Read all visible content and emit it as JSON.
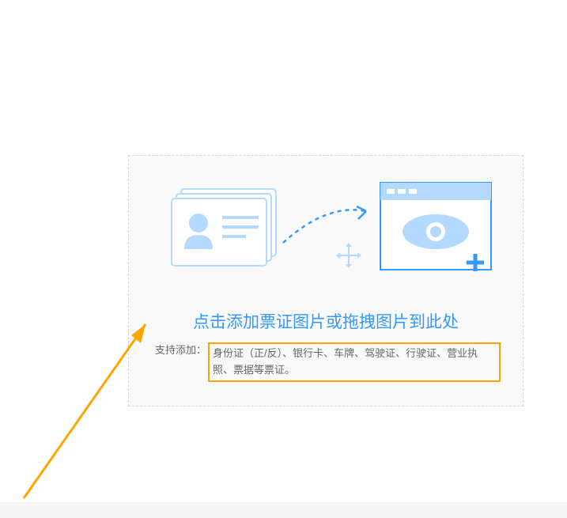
{
  "upload": {
    "title": "点击添加票证图片或拖拽图片到此处",
    "support_label": "支持添加：",
    "support_text": "身份证（正/反）、银行卡、车牌、驾驶证、行驶证、营业执照、票据等票证。"
  },
  "icons": {
    "id_card": "id-card-stack-icon",
    "arrow_dashed": "dashed-arrow-icon",
    "move_cursor": "move-cursor-icon",
    "preview_eye": "preview-window-eye-icon",
    "annotation_arrow": "orange-annotation-arrow"
  },
  "colors": {
    "accent": "#3399ff",
    "light_accent": "#b3d9ff",
    "highlight_border": "#ffa500",
    "annotation": "#ffa500"
  }
}
